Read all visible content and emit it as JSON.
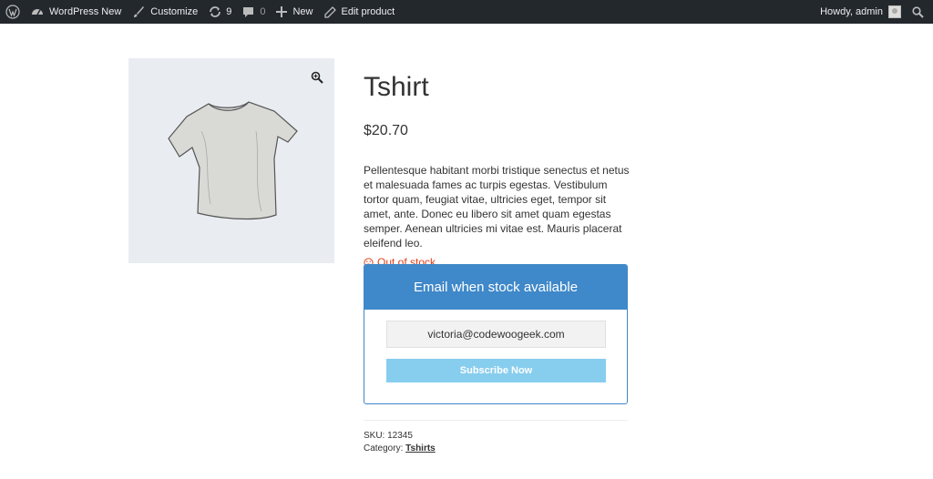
{
  "adminbar": {
    "site_name": "WordPress New",
    "customize": "Customize",
    "updates_count": "9",
    "comments_count": "0",
    "new": "New",
    "edit_product": "Edit product",
    "howdy": "Howdy, admin"
  },
  "product": {
    "title": "Tshirt",
    "price": "$20.70",
    "description": "Pellentesque habitant morbi tristique senectus et netus et malesuada fames ac turpis egestas. Vestibulum tortor quam, feugiat vitae, ultricies eget, tempor sit amet, ante. Donec eu libero sit amet quam egestas semper. Aenean ultricies mi vitae est. Mauris placerat eleifend leo.",
    "stock_status": "Out of stock"
  },
  "notify": {
    "heading": "Email when stock available",
    "email_value": "victoria@codewoogeek.com",
    "button_label": "Subscribe Now"
  },
  "meta": {
    "sku_label": "SKU:",
    "sku_value": "12345",
    "category_label": "Category:",
    "category_value": "Tshirts"
  },
  "colors": {
    "adminbar_bg": "#23282d",
    "accent_blue": "#3f88c9",
    "button_light_blue": "#87cdee",
    "out_of_stock_red": "#e2401c"
  }
}
